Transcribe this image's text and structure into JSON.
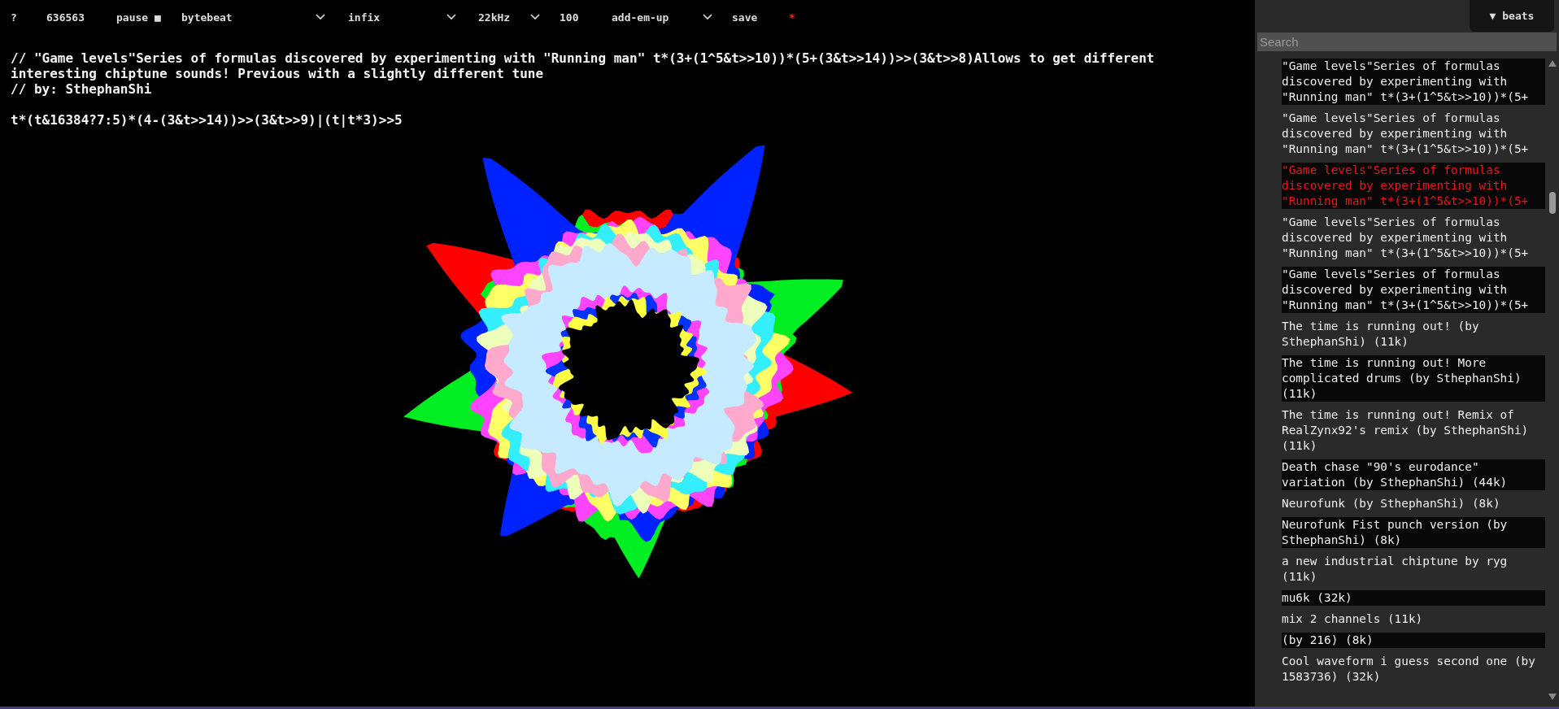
{
  "toolbar": {
    "help": "?",
    "time": "636563",
    "pause": "pause ■",
    "mode_select": "bytebeat",
    "expression_select": "infix",
    "rate_select": "22kHz",
    "volume": "100",
    "mix_select": "add-em-up",
    "save": "save",
    "unsaved_mark": "*"
  },
  "code": {
    "comment_lines": [
      "// \"Game levels\"Series of formulas discovered by experimenting with \"Running man\" t*(3+(1^5&t>>10))*(5+(3&t>>14))>>(3&t>>8)Allows to get different interesting chiptune sounds! Previous with a slightly different tune",
      "// by: SthephanShi"
    ],
    "formula": "t*(t&16384?7:5)*(4-(3&t>>14))>>(3&t>>9)|(t|t*3)>>5"
  },
  "sidebar": {
    "toggle": "▼ beats",
    "search": {
      "placeholder": "Search"
    },
    "items": [
      {
        "text": "\"Game levels\"Series of formulas discovered by experimenting with \"Running man\" t*(3+(1^5&t>>10))*(5+",
        "selected": false
      },
      {
        "text": "\"Game levels\"Series of formulas discovered by experimenting with \"Running man\" t*(3+(1^5&t>>10))*(5+",
        "selected": false
      },
      {
        "text": "\"Game levels\"Series of formulas discovered by experimenting with \"Running man\" t*(3+(1^5&t>>10))*(5+",
        "selected": true
      },
      {
        "text": "\"Game levels\"Series of formulas discovered by experimenting with \"Running man\" t*(3+(1^5&t>>10))*(5+",
        "selected": false
      },
      {
        "text": "\"Game levels\"Series of formulas discovered by experimenting with \"Running man\" t*(3+(1^5&t>>10))*(5+",
        "selected": false
      },
      {
        "text": "The time is running out! (by SthephanShi) (11k)",
        "selected": false
      },
      {
        "text": "The time is running out! More complicated drums (by SthephanShi) (11k)",
        "selected": false
      },
      {
        "text": "The time is running out! Remix of RealZynx92's remix (by SthephanShi) (11k)",
        "selected": false
      },
      {
        "text": "Death chase \"90's eurodance\" variation (by SthephanShi) (44k)",
        "selected": false
      },
      {
        "text": "Neurofunk (by SthephanShi) (8k)",
        "selected": false
      },
      {
        "text": "Neurofunk Fist punch version (by SthephanShi) (8k)",
        "selected": false
      },
      {
        "text": "a new industrial chiptune by ryg (11k)",
        "selected": false
      },
      {
        "text": "mu6k (32k)",
        "selected": false
      },
      {
        "text": "mix 2 channels (11k)",
        "selected": false
      },
      {
        "text": "(by 216) (8k)",
        "selected": false
      },
      {
        "text": "Cool waveform i guess second one (by 1583736) (32k)",
        "selected": false
      }
    ]
  }
}
